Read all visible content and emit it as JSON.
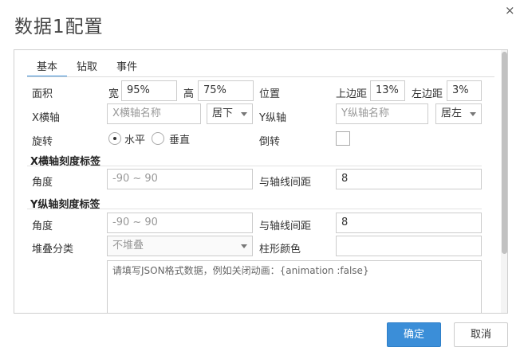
{
  "dialog": {
    "title": "数据1配置",
    "close_icon": "×"
  },
  "tabs": [
    {
      "label": "基本",
      "active": true
    },
    {
      "label": "钻取",
      "active": false
    },
    {
      "label": "事件",
      "active": false
    }
  ],
  "area": {
    "label": "面积",
    "width_label": "宽",
    "width_value": "95%",
    "height_label": "高",
    "height_value": "75%"
  },
  "position": {
    "label": "位置",
    "top_margin_label": "上边距",
    "top_margin_value": "13%",
    "left_margin_label": "左边距",
    "left_margin_value": "3%"
  },
  "x_axis": {
    "label": "X横轴",
    "name_placeholder": "X横轴名称",
    "align_value": "居下"
  },
  "y_axis": {
    "label": "Y纵轴",
    "name_placeholder": "Y纵轴名称",
    "align_value": "居左"
  },
  "rotate": {
    "label": "旋转",
    "options": [
      {
        "label": "水平",
        "selected": true
      },
      {
        "label": "垂直",
        "selected": false
      }
    ]
  },
  "invert": {
    "label": "倒转",
    "checked": false
  },
  "x_tick": {
    "section_title": "X横轴刻度标签",
    "angle_label": "角度",
    "angle_placeholder": "-90 ~ 90",
    "distance_label": "与轴线间距",
    "distance_value": "8"
  },
  "y_tick": {
    "section_title": "Y纵轴刻度标签",
    "angle_label": "角度",
    "angle_placeholder": "-90 ~ 90",
    "distance_label": "与轴线间距",
    "distance_value": "8"
  },
  "stack": {
    "label": "堆叠分类",
    "value": "不堆叠"
  },
  "bar_color": {
    "label": "柱形颜色",
    "value": ""
  },
  "json_config": {
    "placeholder": "请填写JSON格式数据，例如关闭动画：{animation :false}"
  },
  "footer": {
    "ok_label": "确定",
    "cancel_label": "取消"
  },
  "colors": {
    "accent": "#3b8ed8",
    "border": "#cccccc",
    "text": "#333333"
  }
}
